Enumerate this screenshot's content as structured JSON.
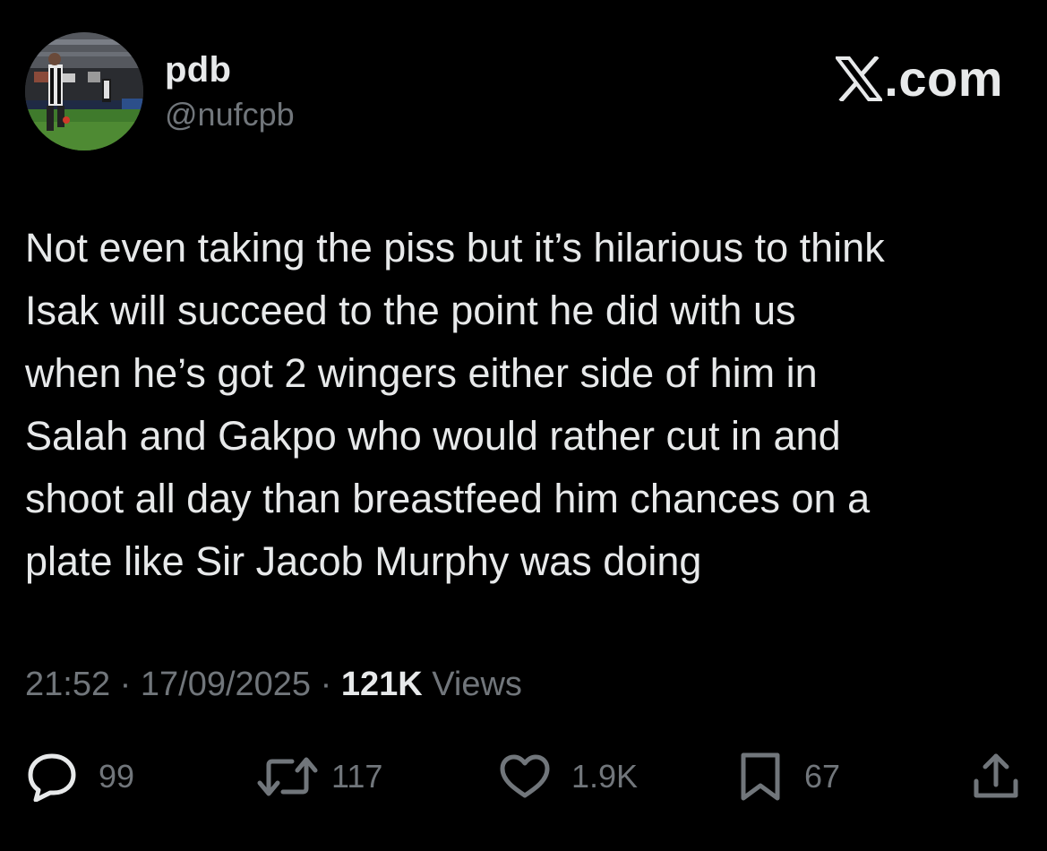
{
  "author": {
    "display_name": "pdb",
    "handle": "@nufcpb",
    "avatar_icon": "profile-photo-football-player"
  },
  "brand": {
    "icon": "x-logo-icon",
    "text": ".com"
  },
  "tweet": {
    "text": "Not even taking the piss but it’s hilarious to think\nIsak will succeed to the point he did with us\nwhen he’s got 2 wingers either side of him in\nSalah and Gakpo who would rather cut in and\nshoot all day  than breastfeed him chances on a\nplate like Sir Jacob Murphy was doing",
    "time": "21:52",
    "date": "17/09/2025",
    "separator": "·",
    "views_count": "121K",
    "views_label": "Views"
  },
  "actions": {
    "replies": {
      "icon": "reply-icon",
      "count": "99"
    },
    "reposts": {
      "icon": "repost-icon",
      "count": "117"
    },
    "likes": {
      "icon": "heart-icon",
      "count": "1.9K"
    },
    "bookmarks": {
      "icon": "bookmark-icon",
      "count": "67"
    },
    "share": {
      "icon": "share-icon"
    }
  },
  "colors": {
    "background": "#000000",
    "primary_text": "#e7e9ea",
    "secondary_text": "#71767b"
  }
}
